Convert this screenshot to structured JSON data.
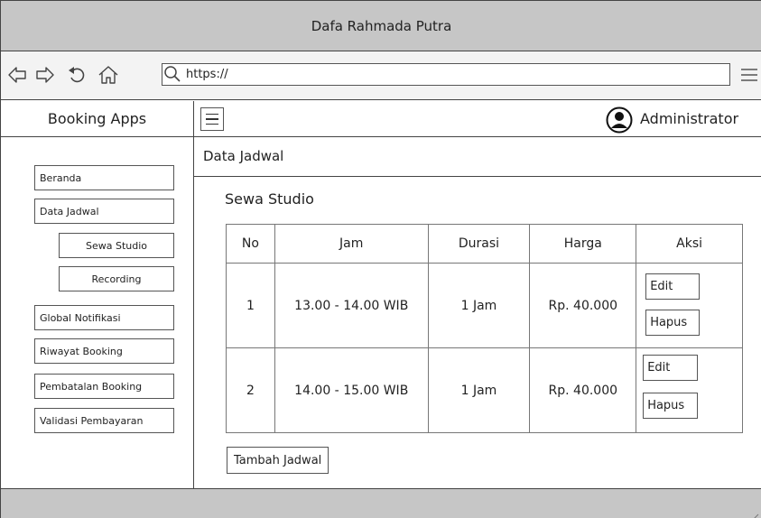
{
  "window": {
    "title": "Dafa Rahmada Putra"
  },
  "browser": {
    "url": "https://",
    "icons": [
      "back-icon",
      "forward-icon",
      "reload-icon",
      "home-icon",
      "search-icon",
      "menu-icon"
    ]
  },
  "sidebar": {
    "app_title": "Booking Apps",
    "items": [
      {
        "label": "Beranda"
      },
      {
        "label": "Data Jadwal"
      },
      {
        "label": "Sewa Studio"
      },
      {
        "label": "Recording"
      },
      {
        "label": "Global Notifikasi"
      },
      {
        "label": "Riwayat Booking"
      },
      {
        "label": "Pembatalan Booking"
      },
      {
        "label": "Validasi Pembayaran"
      }
    ]
  },
  "topbar": {
    "user_label": "Administrator"
  },
  "main": {
    "page_title": "Data Jadwal",
    "section_title": "Sewa Studio",
    "table": {
      "headers": [
        "No",
        "Jam",
        "Durasi",
        "Harga",
        "Aksi"
      ],
      "rows": [
        {
          "no": "1",
          "jam": "13.00 - 14.00 WIB",
          "durasi": "1 Jam",
          "harga": "Rp. 40.000",
          "edit": "Edit",
          "hapus": "Hapus"
        },
        {
          "no": "2",
          "jam": "14.00 - 15.00 WIB",
          "durasi": "1 Jam",
          "harga": "Rp. 40.000",
          "edit": "Edit",
          "hapus": "Hapus"
        }
      ]
    },
    "add_button": "Tambah Jadwal"
  }
}
